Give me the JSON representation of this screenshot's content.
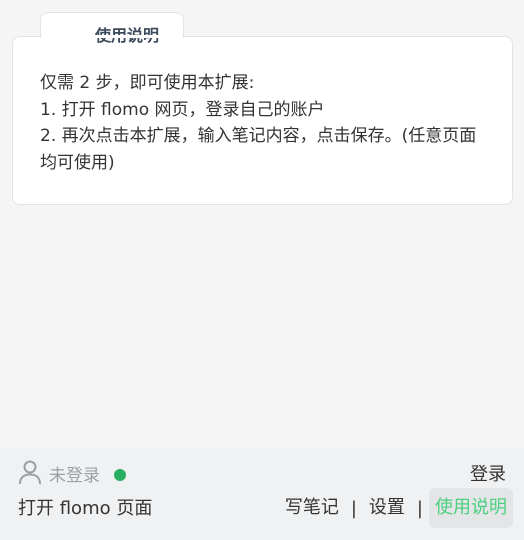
{
  "tab": {
    "title": "使用说明"
  },
  "instructions": {
    "lines": [
      "仅需 2 步，即可使用本扩展:",
      "1. 打开 flomo 网页，登录自己的账户",
      "2. 再次点击本扩展，输入笔记内容，点击保存。(任意页面均可使用)"
    ]
  },
  "footer": {
    "user_icon": "user-icon",
    "status_text": "未登录",
    "status_color": "#27ae60",
    "login_label": "登录",
    "open_flomo_label": "打开 flomo 页面",
    "nav": {
      "write_label": "写笔记",
      "settings_label": "设置",
      "help_label": "使用说明",
      "separator": "|"
    },
    "accent_color": "#4cd080"
  }
}
